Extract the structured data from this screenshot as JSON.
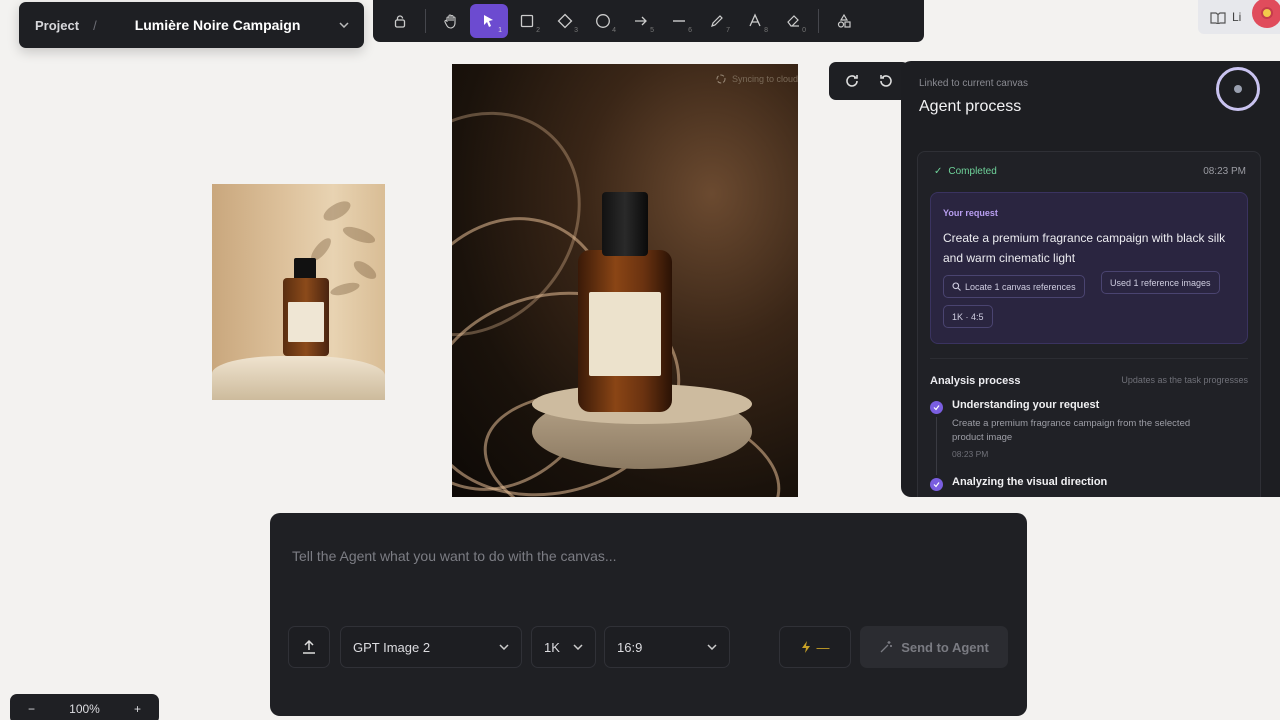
{
  "project": {
    "label": "Project",
    "separator": "/",
    "name": "Lumière Noire Campaign"
  },
  "toolbar": {
    "tools": [
      {
        "name": "lock",
        "key": ""
      },
      {
        "name": "hand",
        "key": ""
      },
      {
        "name": "select",
        "key": "1"
      },
      {
        "name": "rectangle",
        "key": "2"
      },
      {
        "name": "diamond",
        "key": "3"
      },
      {
        "name": "ellipse",
        "key": "4"
      },
      {
        "name": "arrow",
        "key": "5"
      },
      {
        "name": "line",
        "key": "6"
      },
      {
        "name": "pencil",
        "key": "7"
      },
      {
        "name": "text",
        "key": "8"
      },
      {
        "name": "eraser",
        "key": "0"
      },
      {
        "name": "shapes",
        "key": ""
      }
    ]
  },
  "topright": {
    "label": "Li"
  },
  "canvas": {
    "sync_status": "Syncing to cloud"
  },
  "agent": {
    "linked": "Linked to current canvas",
    "title": "Agent process",
    "status": "Completed",
    "time": "08:23 PM",
    "request_label": "Your request",
    "request_text": "Create a premium fragrance campaign with black silk and warm cinematic light",
    "chips": [
      "Locate 1 canvas references",
      "Used 1 reference images",
      "1K · 4:5"
    ],
    "analysis_title": "Analysis process",
    "analysis_sub": "Updates as the task progresses",
    "steps": [
      {
        "title": "Understanding your request",
        "desc": "Create a premium fragrance campaign from the selected product image",
        "time": "08:23 PM"
      },
      {
        "title": "Analyzing the visual direction",
        "desc": "",
        "time": ""
      }
    ]
  },
  "prompt": {
    "placeholder": "Tell the Agent what you want to do with the canvas...",
    "model": "GPT Image 2",
    "resolution": "1K",
    "ratio": "16:9",
    "credits": "—",
    "send": "Send to Agent"
  },
  "zoom": {
    "minus": "−",
    "level": "100%",
    "plus": "+"
  },
  "colors": {
    "accent": "#6c4bd0",
    "success": "#6fd39a",
    "panel": "#1d1e22"
  }
}
